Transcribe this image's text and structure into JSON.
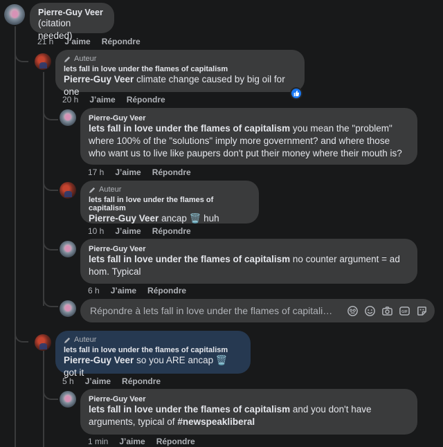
{
  "users": {
    "pg": "Pierre-Guy Veer",
    "lf": "lets fall in love under the flames of capitalism"
  },
  "author_badge": "Auteur",
  "actions": {
    "like": "J’aime",
    "reply": "Répondre"
  },
  "comments": [
    {
      "id": "c1",
      "text": "(citation needed)",
      "time": "21 h"
    },
    {
      "id": "c2",
      "mention": "Pierre-Guy Veer",
      "text": " climate change caused by big oil for one",
      "time": "20 h",
      "reaction": "like"
    },
    {
      "id": "c3",
      "mention": "lets fall in love under the flames of capitalism",
      "text": " you mean the \"problem\" where 100% of the \"solutions\" imply more government? and where those who want us to live like paupers don't put their money where their mouth is?",
      "time": "17 h"
    },
    {
      "id": "c4",
      "mention": "Pierre-Guy Veer",
      "text": " ancap 🗑️ huh",
      "time": "10 h"
    },
    {
      "id": "c5",
      "mention": "lets fall in love under the flames of capitalism",
      "text": " no counter argument = ad hom. Typical",
      "time": "6 h"
    },
    {
      "id": "c6",
      "mention": "Pierre-Guy Veer",
      "text": " so you ARE ancap 🗑️ got it",
      "time": "5 h"
    },
    {
      "id": "c7",
      "mention": "lets fall in love under the flames of capitalism",
      "text": " and you don't have arguments, typical of ",
      "hashtag": "#newspeakliberal",
      "time": "1 min"
    }
  ],
  "reply_box": {
    "placeholder": "Répondre à lets fall in love under the flames of capitali…"
  },
  "colors": {
    "background": "#18191a",
    "bubble": "#3a3b3c",
    "highlight": "#263951",
    "like_blue": "#1877f2"
  }
}
